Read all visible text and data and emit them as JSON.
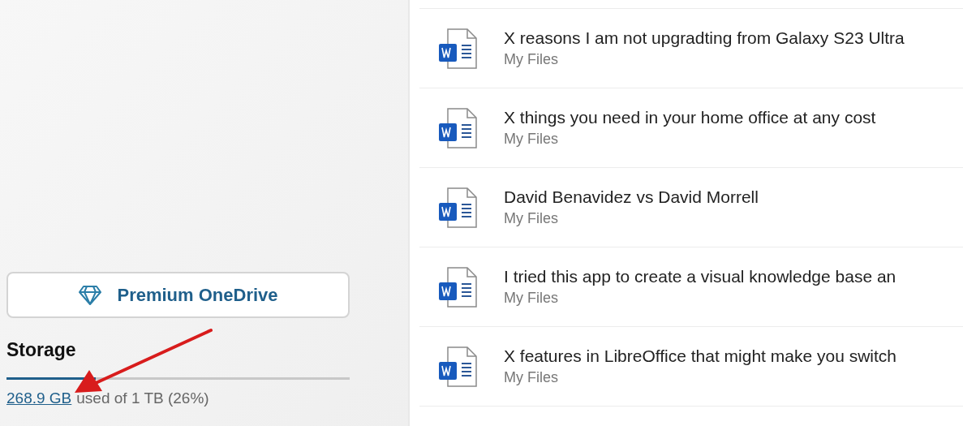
{
  "sidebar": {
    "premium_button": {
      "label": "Premium OneDrive"
    },
    "storage": {
      "heading": "Storage",
      "level": 0.26,
      "used": "268.9 GB",
      "detail": "used of 1 TB (26%)"
    }
  },
  "annotation": {
    "kind": "arrow"
  },
  "files": [
    {
      "title": "X reasons I am not upgradting from Galaxy S23 Ultra",
      "location": "My Files"
    },
    {
      "title": "X things you need in your home office at any cost",
      "location": "My Files"
    },
    {
      "title": "David Benavidez vs David Morrell",
      "location": "My Files"
    },
    {
      "title": "I tried this app to create a visual knowledge base an",
      "location": "My Files"
    },
    {
      "title": "X features in LibreOffice that might make you switch",
      "location": "My Files"
    }
  ]
}
